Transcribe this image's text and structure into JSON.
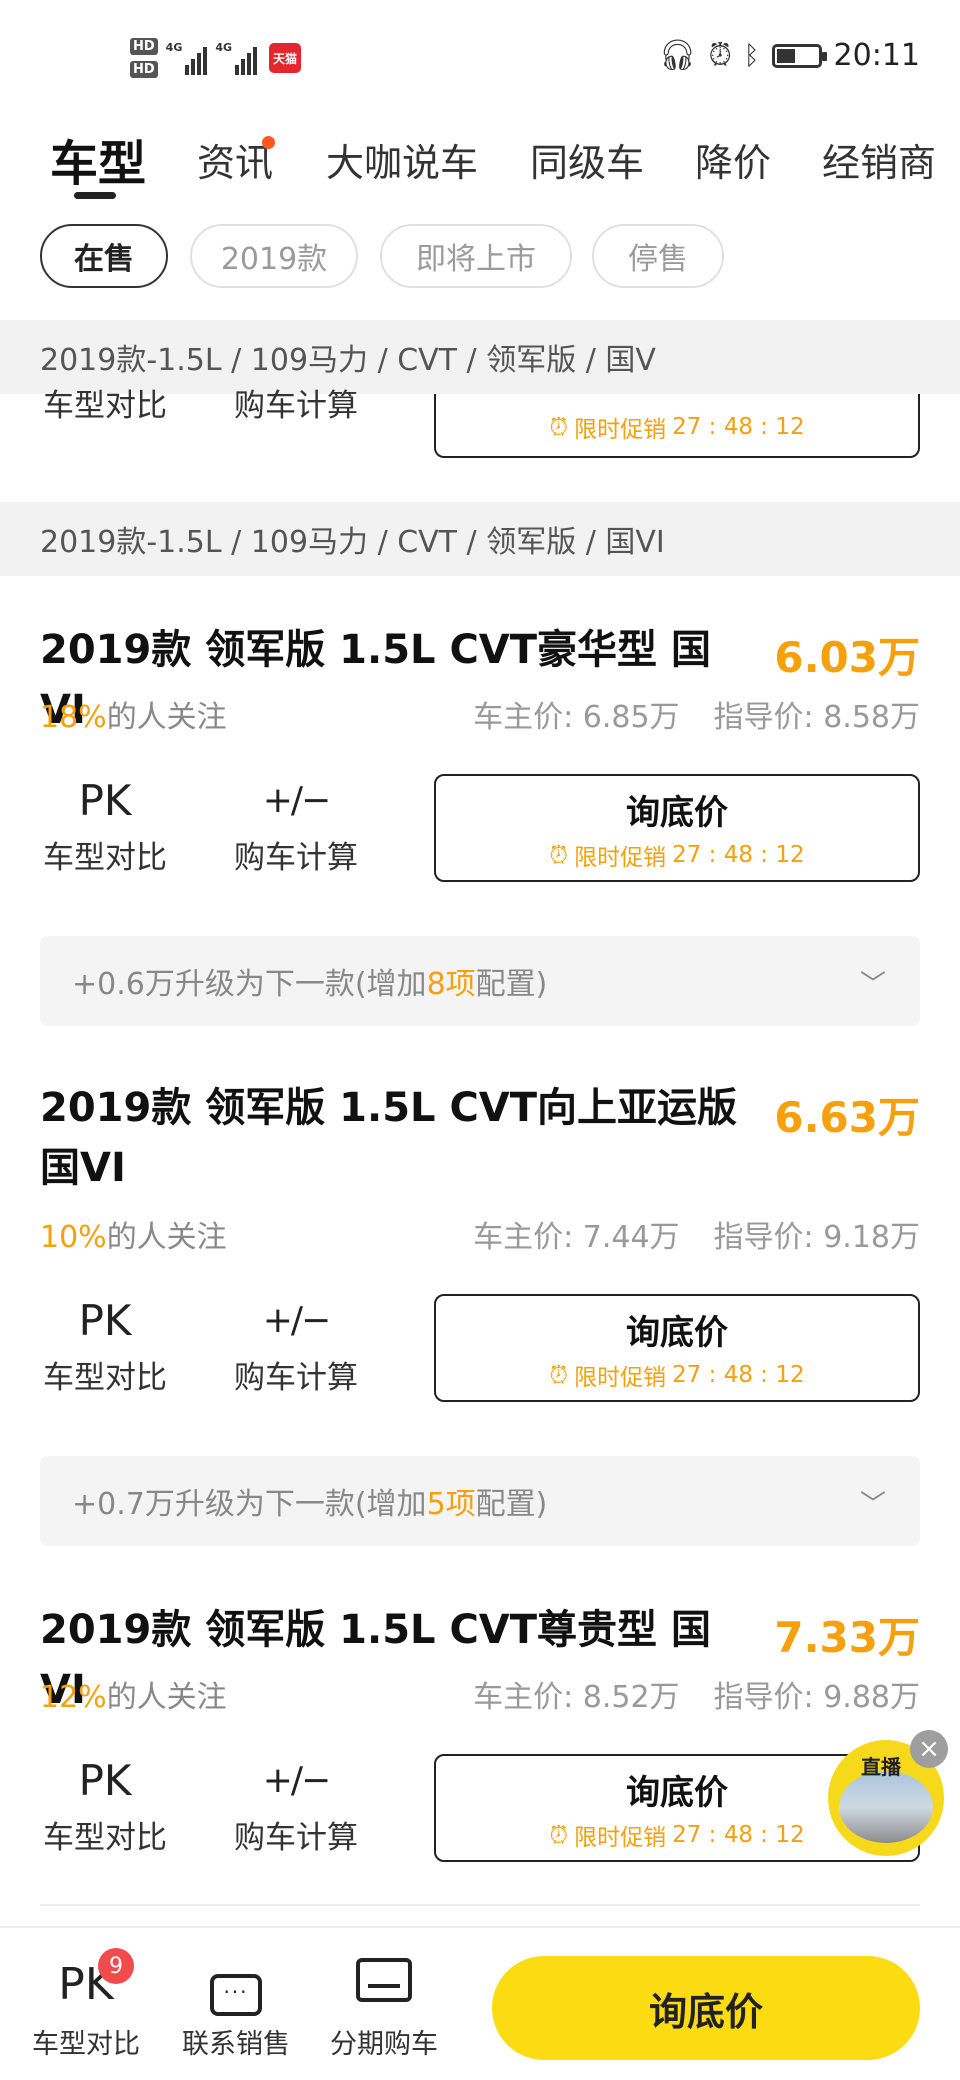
{
  "status_bar": {
    "hd1": "HD",
    "hd2": "HD",
    "net1": "4G",
    "net2": "4G",
    "tmall_label": "天猫",
    "time": "20:11"
  },
  "tabs": [
    {
      "label": "车型"
    },
    {
      "label": "资讯"
    },
    {
      "label": "大咖说车"
    },
    {
      "label": "同级车"
    },
    {
      "label": "降价"
    },
    {
      "label": "经销商"
    }
  ],
  "filters": [
    {
      "label": "在售"
    },
    {
      "label": "2019款"
    },
    {
      "label": "即将上市"
    },
    {
      "label": "停售"
    }
  ],
  "groups": [
    {
      "header": "2019款-1.5L / 109马力 / CVT / 领军版 / 国V"
    },
    {
      "header": "2019款-1.5L / 109马力 / CVT / 领军版 / 国VI"
    }
  ],
  "actions": {
    "pk_icon": "PK",
    "pk_label": "车型对比",
    "calc_icon": "+/−",
    "calc_label": "购车计算",
    "ask_label": "询底价",
    "promo_label": "限时促销",
    "countdown": "27 : 48 : 12"
  },
  "items": [
    {
      "title": "2019款 领军版 1.5L CVT豪华型 国VI",
      "price": "6.03万",
      "follow_pct": "18%",
      "follow_suffix": "的人关注",
      "owner_price": "车主价: 6.85万",
      "guide_price": "指导价: 8.58万",
      "upgrade_prefix": "+0.6万升级为下一款(增加",
      "upgrade_count": "8项",
      "upgrade_suffix": "配置)"
    },
    {
      "title": "2019款 领军版 1.5L CVT向上亚运版 国VI",
      "price": "6.63万",
      "follow_pct": "10%",
      "follow_suffix": "的人关注",
      "owner_price": "车主价: 7.44万",
      "guide_price": "指导价: 9.18万",
      "upgrade_prefix": "+0.7万升级为下一款(增加",
      "upgrade_count": "5项",
      "upgrade_suffix": "配置)"
    },
    {
      "title": "2019款 领军版 1.5L CVT尊贵型 国VI",
      "price": "7.33万",
      "follow_pct": "12%",
      "follow_suffix": "的人关注",
      "owner_price": "车主价: 8.52万",
      "guide_price": "指导价: 9.88万"
    }
  ],
  "live": {
    "tag": "直播"
  },
  "bottom_bar": {
    "compare_icon": "PK",
    "compare_badge": "9",
    "compare_label": "车型对比",
    "contact_label": "联系销售",
    "finance_label": "分期购车",
    "ask_label": "询底价"
  },
  "colors": {
    "accent": "#f5a00c",
    "cta_yellow": "#fbdc12",
    "badge_red": "#f24b4b",
    "group_bg": "#f2f2f2"
  }
}
